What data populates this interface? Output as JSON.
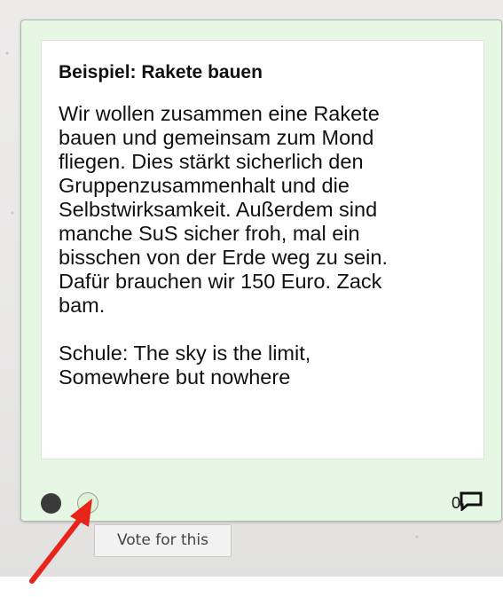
{
  "card": {
    "title": "Beispiel: Rakete bauen",
    "description": "Wir wollen zusammen eine Rakete\nbauen und gemeinsam zum Mond\nfliegen. Dies stärkt sicherlich den\nGruppenzusammenhalt und die\nSelbstwirksamkeit. Außerdem sind\nmanche SuS sicher froh, mal ein\nbisschen von der Erde weg zu sein.\nDafür brauchen wir 150 Euro. Zack\nbam.",
    "school": "Schule: The sky is the limit,\nSomewhere but nowhere",
    "comment_count": "0",
    "background_color": "#e6f7e3"
  },
  "footer_icons": {
    "status_dot": "filled-dot-icon",
    "vote": "vote-circle-icon",
    "comment": "comment-icon"
  },
  "tooltip": {
    "text": "Vote for this"
  },
  "annotation": {
    "arrow_color": "#e8231a"
  }
}
